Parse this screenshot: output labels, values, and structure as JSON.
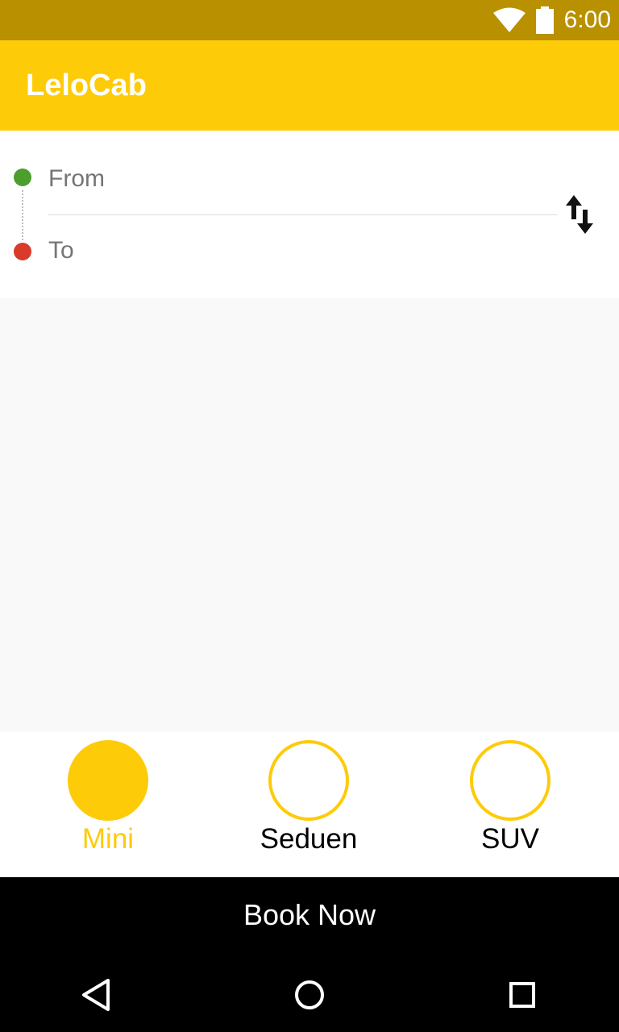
{
  "status_bar": {
    "time": "6:00",
    "icons": [
      "wifi-icon",
      "battery-icon"
    ]
  },
  "app_bar": {
    "title": "LeloCab"
  },
  "route": {
    "from_placeholder": "From",
    "to_placeholder": "To",
    "swap_icon": "swap-vertical-icon"
  },
  "vehicles": [
    {
      "label": "Mini",
      "selected": true
    },
    {
      "label": "Seduen",
      "selected": false
    },
    {
      "label": "SUV",
      "selected": false
    }
  ],
  "book_button": {
    "label": "Book Now"
  },
  "nav_bar": {
    "icons": [
      "back-icon",
      "home-icon",
      "recents-icon"
    ]
  },
  "colors": {
    "accent": "#fecb09",
    "status_bar": "#b99000",
    "from_dot": "#4c9e2f",
    "to_dot": "#d93a2a",
    "book_bar": "#000000"
  }
}
